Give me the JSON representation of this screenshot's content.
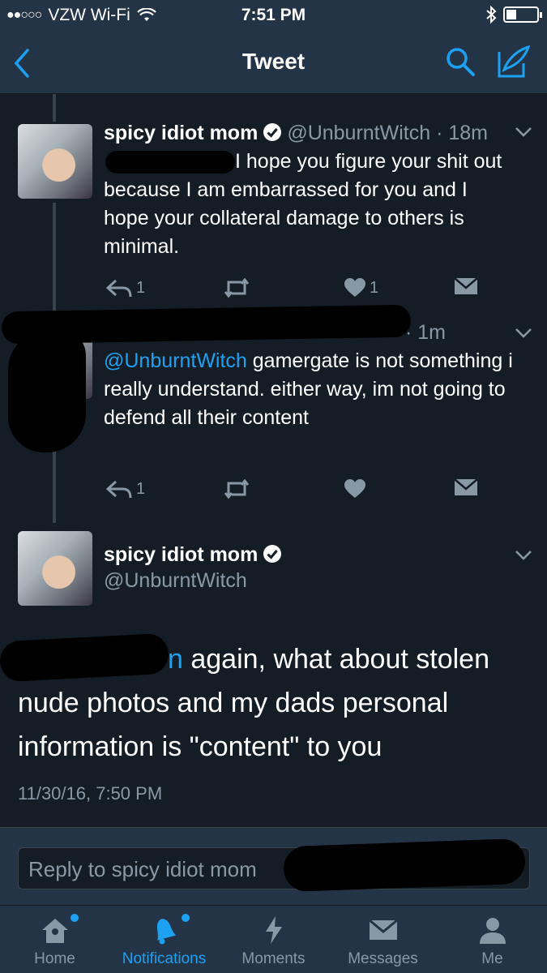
{
  "status_bar": {
    "carrier": "VZW Wi-Fi",
    "time": "7:51 PM"
  },
  "nav": {
    "title": "Tweet"
  },
  "tweets": [
    {
      "name": "spicy idiot mom",
      "handle": "@UnburntWitch",
      "time": "· 18m",
      "text": "I hope you figure your shit out because I am embarrassed for you and I hope your collateral damage to others is minimal.",
      "replies": "1",
      "likes": "1"
    },
    {
      "time": "· 1m",
      "mention": "@UnburntWitch",
      "text": " gamergate is not something i really understand. either way, im not going to defend all their content",
      "replies": "1"
    }
  ],
  "main_tweet": {
    "name": "spicy idiot mom",
    "handle": "@UnburntWitch",
    "mention_tail": "n",
    "text": " again, what about stolen nude photos and my dads personal information is \"content\" to you",
    "date": "11/30/16, 7:50 PM"
  },
  "reply": {
    "placeholder": "Reply to spicy idiot mom"
  },
  "tabs": [
    {
      "label": "Home",
      "icon": "home-icon"
    },
    {
      "label": "Notifications",
      "icon": "bell-icon"
    },
    {
      "label": "Moments",
      "icon": "lightning-icon"
    },
    {
      "label": "Messages",
      "icon": "envelope-icon"
    },
    {
      "label": "Me",
      "icon": "person-icon"
    }
  ],
  "colors": {
    "background": "#141d26",
    "bar": "#243447",
    "accent": "#1da1f2",
    "muted": "#8899a6"
  }
}
